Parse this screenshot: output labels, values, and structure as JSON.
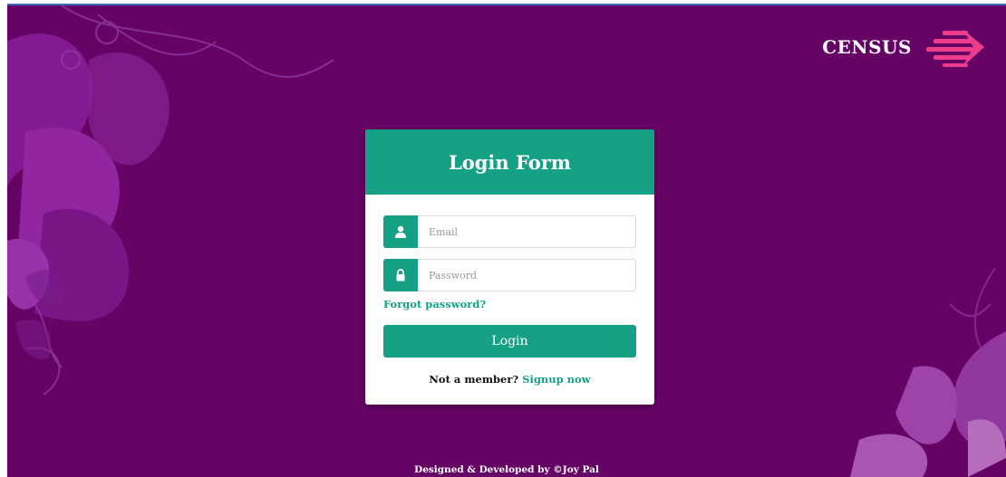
{
  "brand": {
    "name": "CENSUS",
    "icon": "fast-forward-lines-icon",
    "icon_color": "#ee3c8c"
  },
  "login_form": {
    "title": "Login Form",
    "email": {
      "placeholder": "Email",
      "value": "",
      "icon": "user-icon"
    },
    "password": {
      "placeholder": "Password",
      "value": "",
      "icon": "lock-icon"
    },
    "forgot_label": "Forgot password?",
    "submit_label": "Login",
    "signup_prompt": "Not a member?",
    "signup_link": "Signup now"
  },
  "footer": {
    "text": "Designed & Developed by ©Joy Pal"
  },
  "colors": {
    "background": "#650465",
    "accent": "#16a085",
    "card": "#ffffff"
  }
}
